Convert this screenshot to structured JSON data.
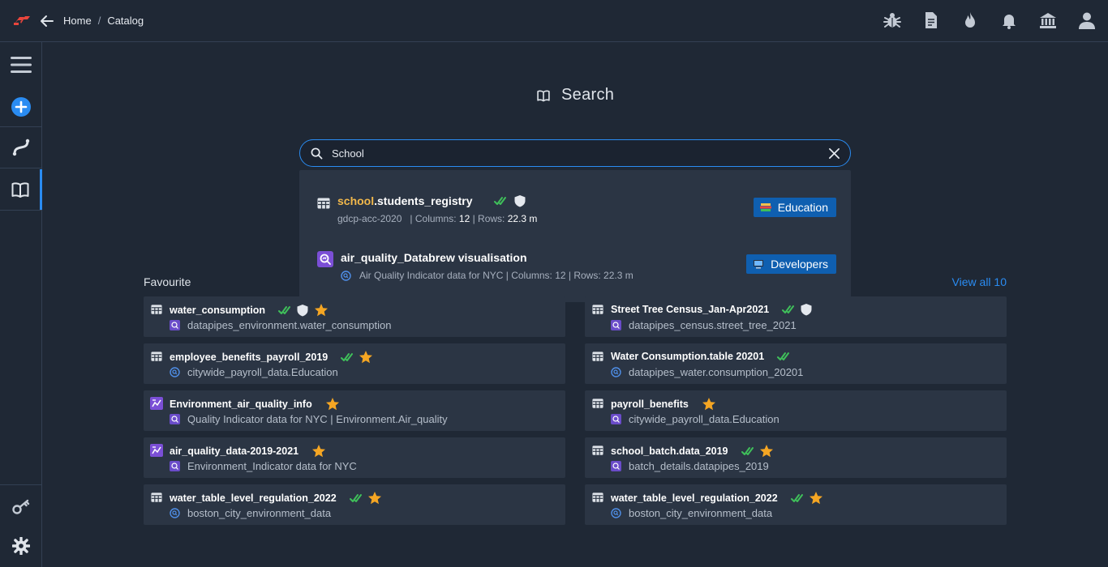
{
  "breadcrumb": {
    "home": "Home",
    "separator": "/",
    "current": "Catalog"
  },
  "page_title": "Search",
  "search": {
    "value": "School",
    "placeholder": ""
  },
  "results": [
    {
      "highlight": "school",
      "rest": ".students_registry",
      "source": "gdcp-acc-2020",
      "columns_label": "Columns:",
      "columns": "12",
      "rows_label": "Rows:",
      "rows": "22.3 m",
      "tag": "Education",
      "icon": "table-icon"
    },
    {
      "title": "air_quality_Databrew visualisation",
      "description": "Air Quality Indicator data for NYC | Columns: 12 | Rows: 22.3 m",
      "tag": "Developers",
      "icon": "visualisation-icon"
    }
  ],
  "favourites": {
    "label": "Favourite",
    "view_all": "View all 10",
    "left": [
      {
        "title": "water_consumption",
        "sub": "datapipes_environment.water_consumption",
        "icon": "table-icon",
        "sub_icon": "dataset-icon"
      },
      {
        "title": "employee_benefits_payroll_2019",
        "sub": "citywide_payroll_data.Education",
        "icon": "table-icon",
        "sub_icon": "query-icon"
      },
      {
        "title": "Environment_air_quality_info",
        "sub": "Quality Indicator data for NYC | Environment.Air_quality",
        "icon": "visualisation-icon",
        "sub_icon": "dataset-icon"
      },
      {
        "title": "air_quality_data-2019-2021",
        "sub": "Environment_Indicator data for NYC",
        "icon": "visualisation-icon",
        "sub_icon": "dataset-icon"
      },
      {
        "title": "water_table_level_regulation_2022",
        "sub": "boston_city_environment_data",
        "icon": "table-icon",
        "sub_icon": "query-icon"
      }
    ],
    "right": [
      {
        "title": "Street Tree Census_Jan-Apr2021",
        "sub": "datapipes_census.street_tree_2021",
        "icon": "table-icon",
        "sub_icon": "dataset-icon"
      },
      {
        "title": "Water Consumption.table 20201",
        "sub": "datapipes_water.consumption_20201",
        "icon": "table-icon",
        "sub_icon": "query-icon"
      },
      {
        "title": "payroll_benefits",
        "sub": "citywide_payroll_data.Education",
        "icon": "table-icon",
        "sub_icon": "dataset-icon"
      },
      {
        "title": "school_batch.data_2019",
        "sub": "batch_details.datapipes_2019",
        "icon": "table-icon",
        "sub_icon": "dataset-icon"
      },
      {
        "title": "water_table_level_regulation_2022",
        "sub": "boston_city_environment_data",
        "icon": "table-icon",
        "sub_icon": "query-icon"
      }
    ]
  },
  "colors": {
    "accent": "#2a8cf2",
    "highlight": "#f2b84b",
    "check": "#3fbf5a",
    "star": "#f5a623",
    "tag_bg": "#0f5fb0"
  }
}
